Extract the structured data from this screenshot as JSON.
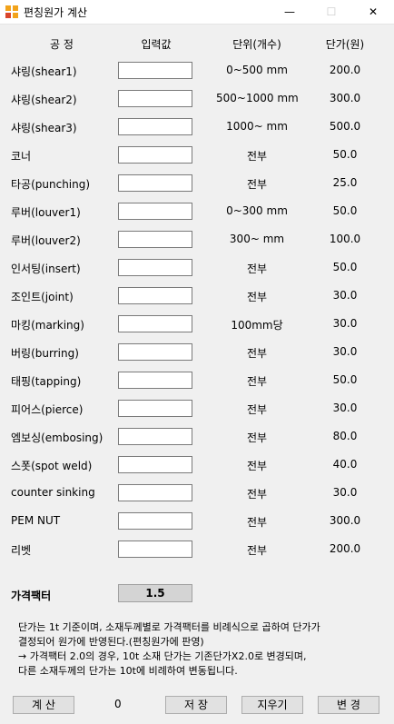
{
  "window": {
    "title": "편칭원가 계산",
    "minimize": "—",
    "maximize": "☐",
    "close": "✕"
  },
  "headers": {
    "process": "공  정",
    "input": "입력값",
    "unit": "단위(개수)",
    "price": "단가(원)"
  },
  "rows": [
    {
      "label": "샤링(shear1)",
      "unit": "0~500 mm",
      "price": "200.0",
      "value": ""
    },
    {
      "label": "샤링(shear2)",
      "unit": "500~1000 mm",
      "price": "300.0",
      "value": ""
    },
    {
      "label": "샤링(shear3)",
      "unit": "1000~ mm",
      "price": "500.0",
      "value": ""
    },
    {
      "label": "코너",
      "unit": "전부",
      "price": "50.0",
      "value": ""
    },
    {
      "label": "타공(punching)",
      "unit": "전부",
      "price": "25.0",
      "value": ""
    },
    {
      "label": "루버(louver1)",
      "unit": "0~300 mm",
      "price": "50.0",
      "value": ""
    },
    {
      "label": "루버(louver2)",
      "unit": "300~ mm",
      "price": "100.0",
      "value": ""
    },
    {
      "label": "인서팅(insert)",
      "unit": "전부",
      "price": "50.0",
      "value": ""
    },
    {
      "label": "조인트(joint)",
      "unit": "전부",
      "price": "30.0",
      "value": ""
    },
    {
      "label": "마킹(marking)",
      "unit": "100mm당",
      "price": "30.0",
      "value": ""
    },
    {
      "label": "버링(burring)",
      "unit": "전부",
      "price": "30.0",
      "value": ""
    },
    {
      "label": "태핑(tapping)",
      "unit": "전부",
      "price": "50.0",
      "value": ""
    },
    {
      "label": "피어스(pierce)",
      "unit": "전부",
      "price": "30.0",
      "value": ""
    },
    {
      "label": "엠보싱(embosing)",
      "unit": "전부",
      "price": "80.0",
      "value": ""
    },
    {
      "label": "스폿(spot weld)",
      "unit": "전부",
      "price": "40.0",
      "value": ""
    },
    {
      "label": "counter sinking",
      "unit": "전부",
      "price": "30.0",
      "value": ""
    },
    {
      "label": "PEM NUT",
      "unit": "전부",
      "price": "300.0",
      "value": ""
    },
    {
      "label": "리벳",
      "unit": "전부",
      "price": "200.0",
      "value": ""
    }
  ],
  "factor": {
    "label": "가격팩터",
    "value": "1.5"
  },
  "notes": [
    "단가는 1t 기준이며, 소재두께별로 가격팩터를 비례식으로 곱하여 단가가",
    "결정되어 원가에 반영된다.(편칭원가에 판영)",
    "→ 가격팩터 2.0의 경우, 10t 소재 단가는 기존단가X2.0로 변경되며,",
    "다른 소재두께의 단가는 10t에 비례하여 변동됩니다."
  ],
  "buttons": {
    "calc": "계 산",
    "save": "저 장",
    "clear": "지우기",
    "change": "변 경"
  },
  "result": "0",
  "colors": {
    "titlebar": "#ffffff",
    "window_bg": "#f0f0f0",
    "factor_bg": "#d4d4d4",
    "icon_orange": "#f2a31b",
    "icon_red": "#d9452b"
  }
}
